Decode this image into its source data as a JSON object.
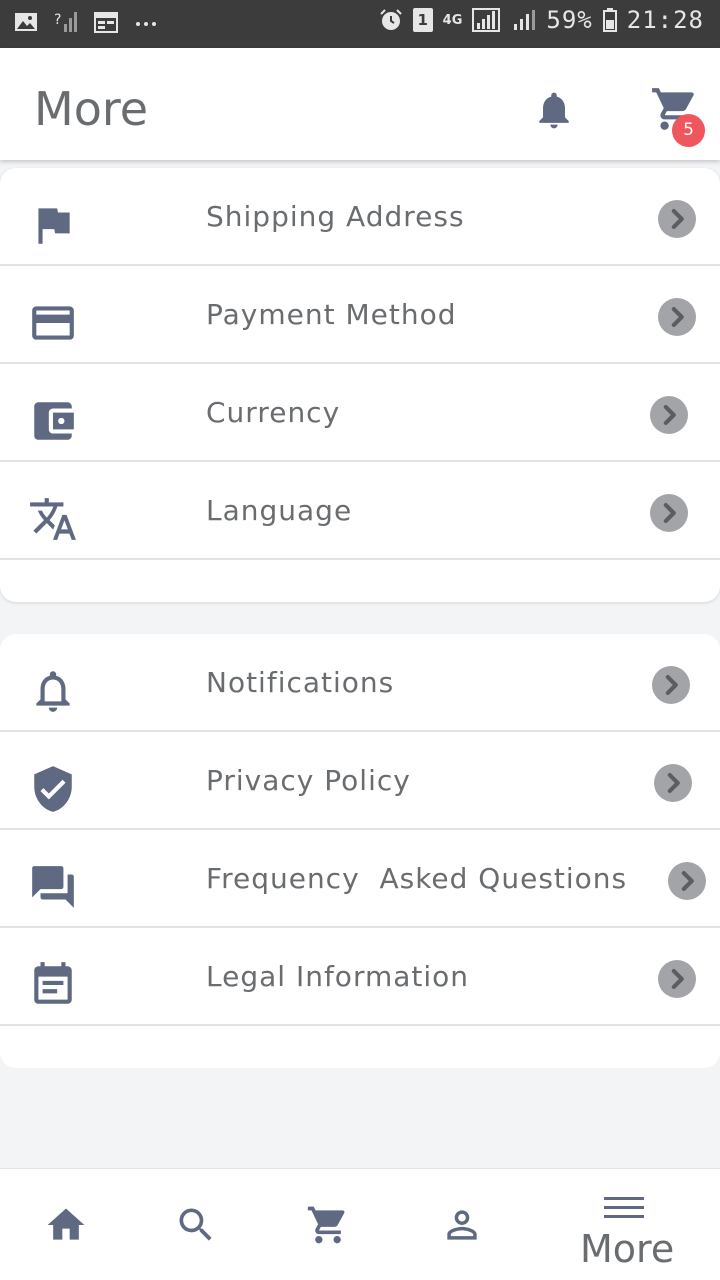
{
  "status_bar": {
    "network": "4G",
    "sim": "1",
    "battery": "59%",
    "time": "21:28",
    "icons": [
      "image-icon",
      "signal-icon",
      "calendar-icon",
      "more-dots-icon",
      "alarm-icon",
      "sim-icon",
      "signal-icon",
      "battery-icon"
    ]
  },
  "header": {
    "title": "More",
    "cart_badge": "5",
    "icons": [
      "bell-icon",
      "cart-icon"
    ]
  },
  "menu": {
    "group1": [
      {
        "label": "Shipping Address",
        "icon": "flag-icon"
      },
      {
        "label": "Payment Method",
        "icon": "credit-card-icon"
      },
      {
        "label": "Currency",
        "icon": "wallet-icon"
      },
      {
        "label": "Language",
        "icon": "translate-icon"
      }
    ],
    "group2": [
      {
        "label": "Notifications",
        "icon": "bell-outline-icon"
      },
      {
        "label": "Privacy Policy",
        "icon": "shield-check-icon"
      },
      {
        "label": "Frequency  Asked Questions",
        "icon": "chat-icon"
      },
      {
        "label": "Legal Information",
        "icon": "event-note-icon"
      }
    ]
  },
  "bottom_nav": {
    "items": [
      "home-icon",
      "search-icon",
      "cart-icon",
      "person-icon",
      "menu-icon"
    ],
    "active_label": "More"
  },
  "colors": {
    "icon": "#5f6a82",
    "text": "#6a6d70",
    "chevron": "#a3a4a8",
    "badge": "#f0565e"
  }
}
